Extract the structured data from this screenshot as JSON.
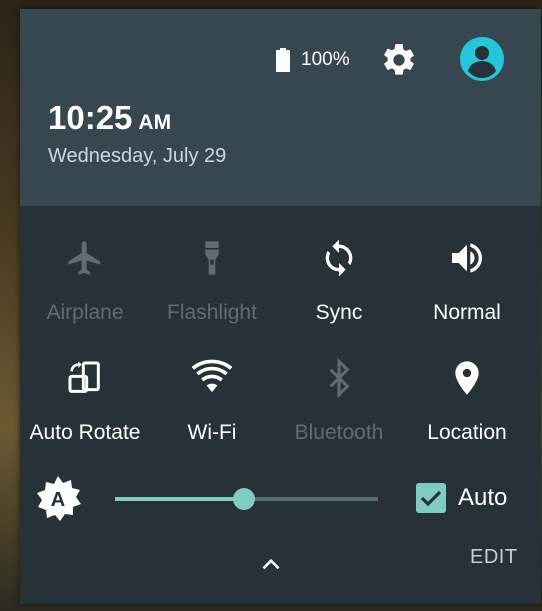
{
  "status": {
    "battery_level": 100,
    "battery_text": "100%"
  },
  "header": {
    "time": "10:25",
    "ampm": "AM",
    "date": "Wednesday, July 29"
  },
  "tiles": [
    {
      "label": "Airplane",
      "icon": "airplane-icon",
      "active": false
    },
    {
      "label": "Flashlight",
      "icon": "flashlight-icon",
      "active": false
    },
    {
      "label": "Sync",
      "icon": "sync-icon",
      "active": true
    },
    {
      "label": "Normal",
      "icon": "volume-icon",
      "active": true
    },
    {
      "label": "Auto Rotate",
      "icon": "auto-rotate-icon",
      "active": true
    },
    {
      "label": "Wi-Fi",
      "icon": "wifi-icon",
      "active": true
    },
    {
      "label": "Bluetooth",
      "icon": "bluetooth-icon",
      "active": false
    },
    {
      "label": "Location",
      "icon": "location-icon",
      "active": true
    }
  ],
  "brightness": {
    "level": 0.49,
    "auto_label": "Auto",
    "auto_checked": true
  },
  "footer": {
    "edit_label": "EDIT"
  },
  "colors": {
    "accent": "#80cbc4",
    "avatar": "#26c6da",
    "panel": "#263238",
    "header": "#37474f",
    "inactive_text": "#5f6d73"
  }
}
